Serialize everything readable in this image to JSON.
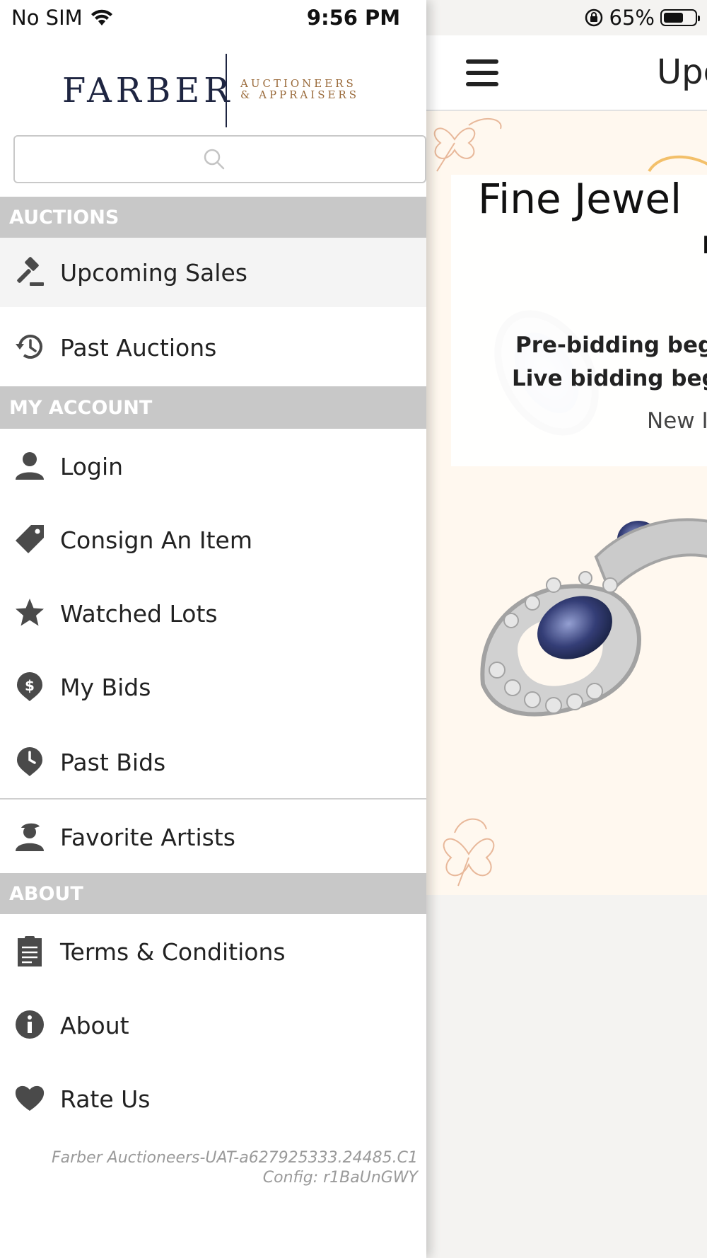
{
  "status_bar": {
    "carrier": "No SIM",
    "time": "9:56 PM",
    "battery_percent": "65%",
    "battery_level": 0.65
  },
  "main_page": {
    "header_title": "Upc",
    "card": {
      "title": "Fine Jewel",
      "line1": "I",
      "line2": "Pre-bidding begi",
      "line3": "Live bidding begi",
      "line4": "New I"
    }
  },
  "drawer": {
    "logo": {
      "name": "FARBER",
      "subtitle_1": "AUCTIONEERS",
      "subtitle_2": "& APPRAISERS"
    },
    "search": {
      "placeholder": ""
    },
    "sections": {
      "auctions": "AUCTIONS",
      "my_account": "MY ACCOUNT",
      "about": "ABOUT"
    },
    "items": [
      {
        "label": "Upcoming Sales",
        "icon": "gavel-icon"
      },
      {
        "label": "Past Auctions",
        "icon": "history-icon"
      },
      {
        "label": "Login",
        "icon": "user-icon"
      },
      {
        "label": "Consign An Item",
        "icon": "tag-icon"
      },
      {
        "label": "Watched Lots",
        "icon": "star-icon"
      },
      {
        "label": "My Bids",
        "icon": "dollar-pin-icon"
      },
      {
        "label": "Past Bids",
        "icon": "clock-pin-icon"
      },
      {
        "label": "Favorite Artists",
        "icon": "artist-icon"
      },
      {
        "label": "Terms & Conditions",
        "icon": "document-icon"
      },
      {
        "label": "About",
        "icon": "info-icon"
      },
      {
        "label": "Rate Us",
        "icon": "heart-icon"
      }
    ],
    "version_line1": "Farber Auctioneers-UAT-a627925333.24485.C1",
    "version_line2": "Config: r1BaUnGWY"
  },
  "colors": {
    "brand_navy": "#1e2541",
    "brand_gold": "#9a6a3a",
    "section_bg": "#c8c8c8",
    "icon_gray": "#4a4a4a",
    "banner_bg": "#fff8ef"
  }
}
